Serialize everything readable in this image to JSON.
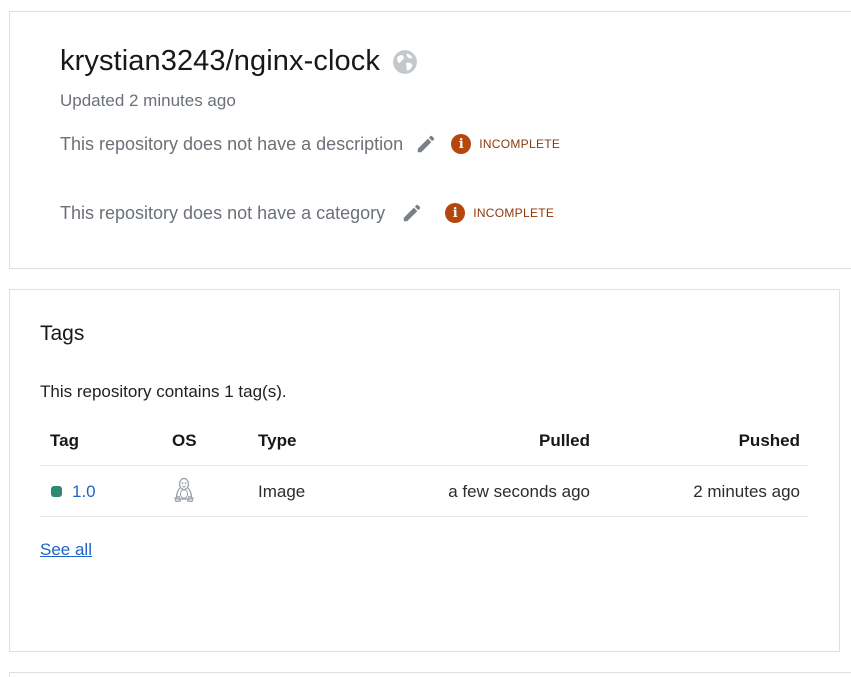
{
  "repo": {
    "title": "krystian3243/nginx-clock",
    "visibility_icon": "globe-icon",
    "updated": "Updated 2 minutes ago",
    "description_text": "This repository does not have a description",
    "category_text": "This repository does not have a category",
    "incomplete_label": "INCOMPLETE",
    "incomplete_icon_glyph": "i",
    "edit_icon": "pencil-icon",
    "badge_color": "#b5470e"
  },
  "tags": {
    "title": "Tags",
    "summary": "This repository contains 1 tag(s).",
    "columns": {
      "tag": "Tag",
      "os": "OS",
      "type": "Type",
      "pulled": "Pulled",
      "pushed": "Pushed"
    },
    "rows": [
      {
        "tag": "1.0",
        "os_icon": "linux-icon",
        "type": "Image",
        "pulled": "a few seconds ago",
        "pushed": "2 minutes ago",
        "status_color": "#2e8a72"
      }
    ],
    "see_all": "See all",
    "link_color": "#1e64c8"
  }
}
